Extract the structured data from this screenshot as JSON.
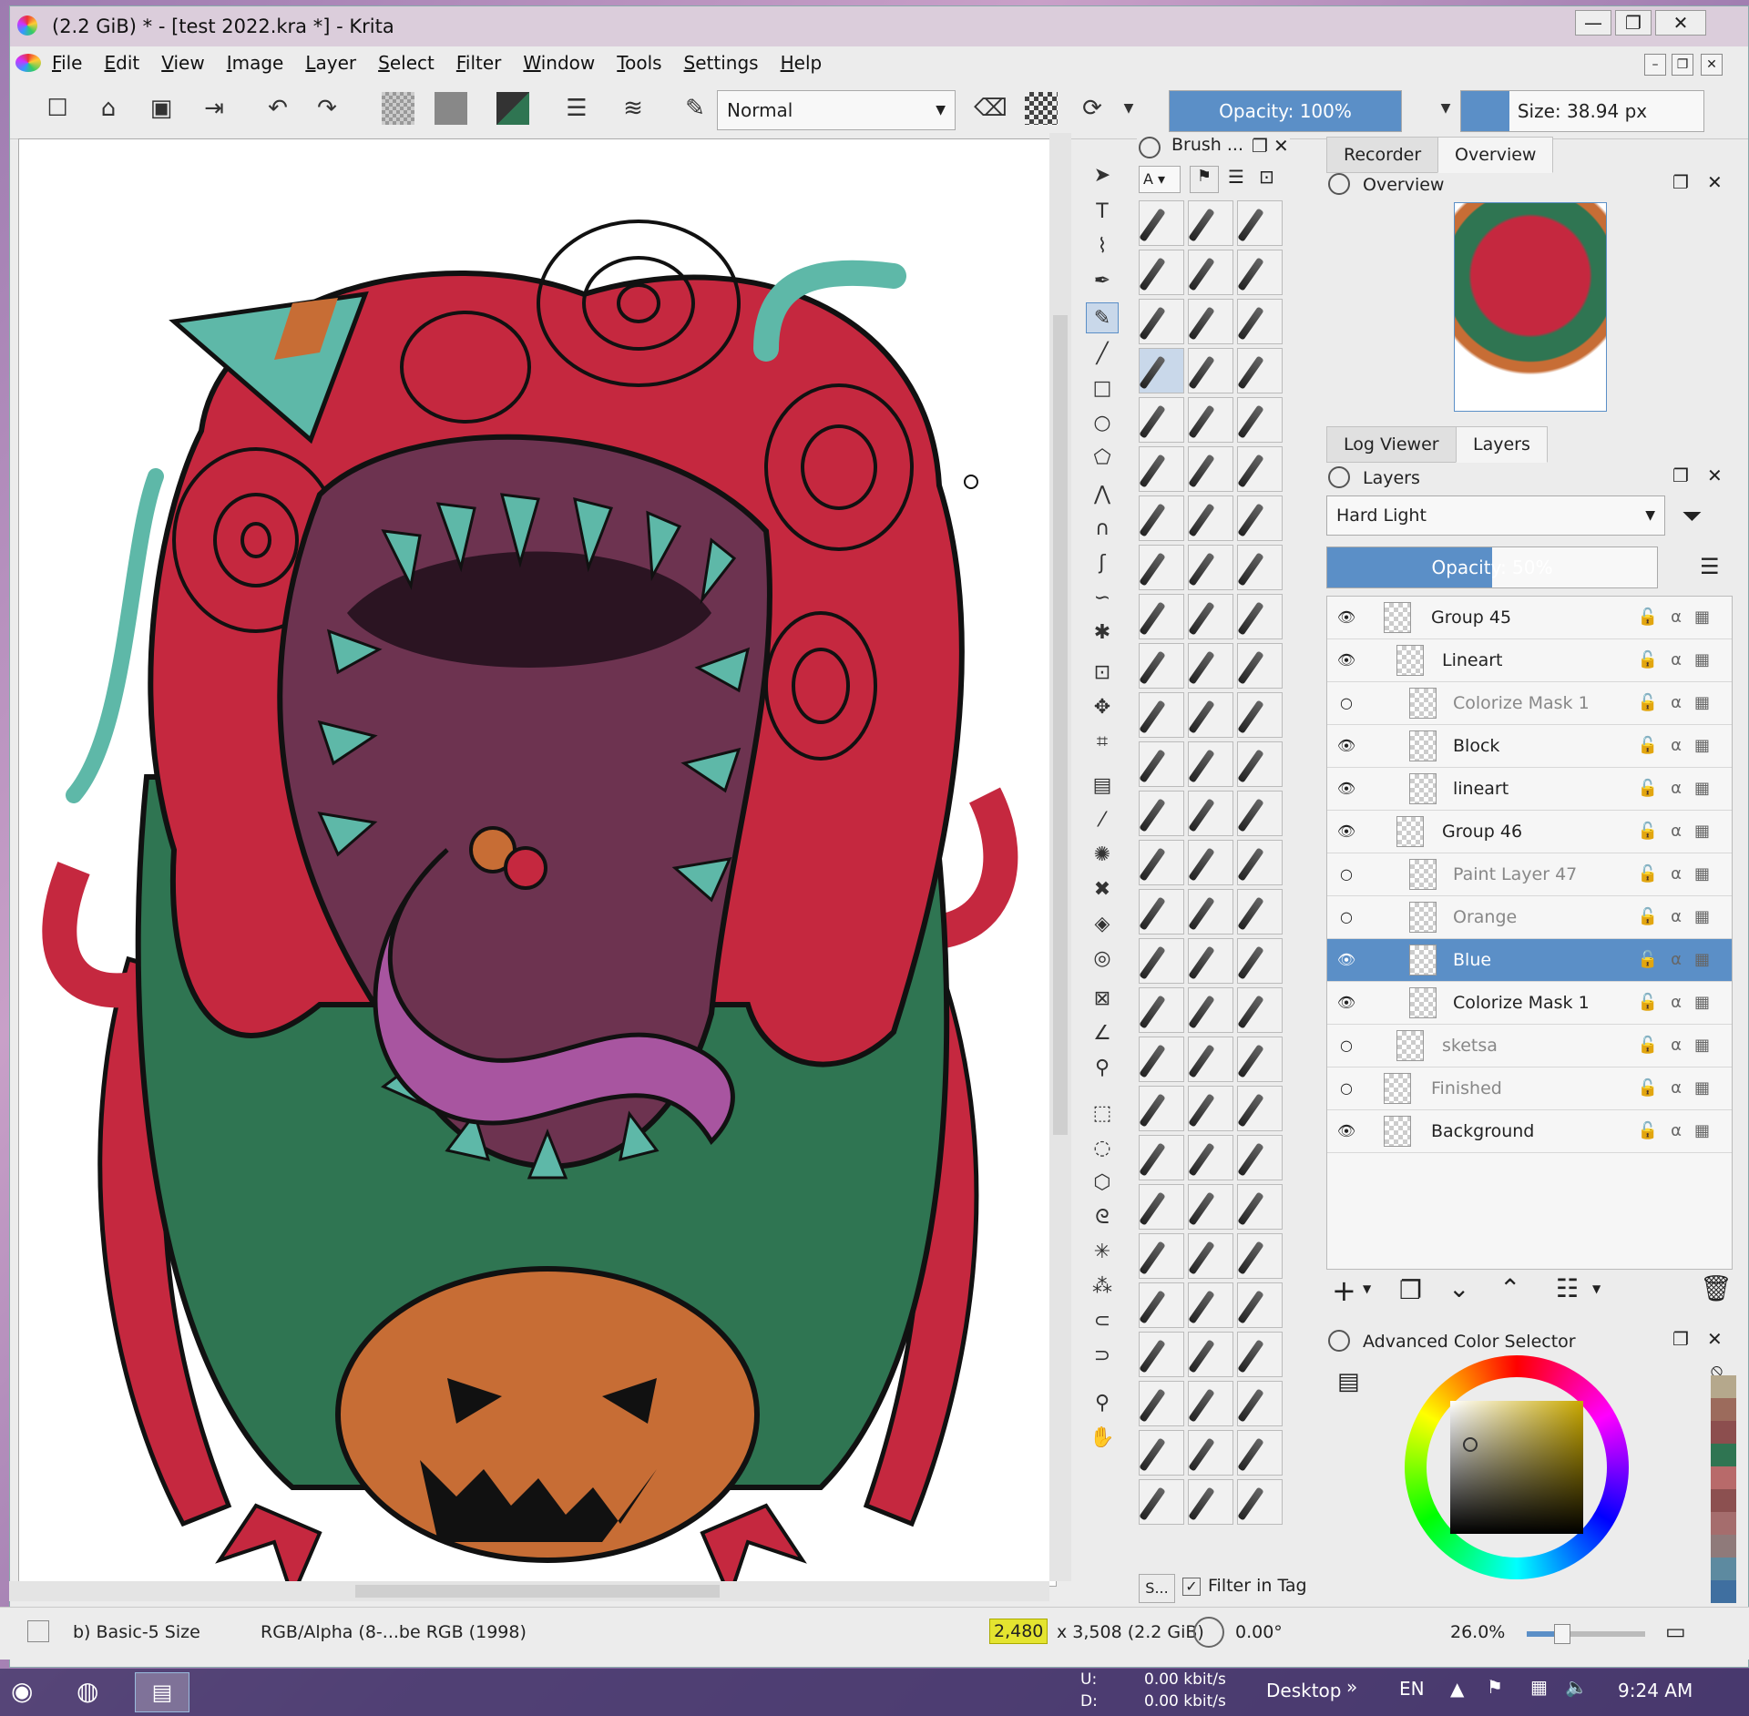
{
  "window": {
    "title": "(2.2 GiB)  * - [test 2022.kra *] - Krita",
    "controls": [
      "—",
      "❐",
      "✕"
    ]
  },
  "menu": [
    "File",
    "Edit",
    "View",
    "Image",
    "Layer",
    "Select",
    "Filter",
    "Window",
    "Tools",
    "Settings",
    "Help"
  ],
  "toolbar": {
    "blend_mode": "Normal",
    "opacity_label": "Opacity: 100%",
    "opacity_value": 1.0,
    "size_label": "Size: 38.94 px",
    "size_fill": 0.2
  },
  "brush_dock": {
    "title": "Brush ...",
    "tag_selector": "A",
    "search_label": "S...",
    "filter_label": "Filter in Tag",
    "filter_checked": true
  },
  "right_tabs_top": [
    "Recorder",
    "Overview"
  ],
  "overview": {
    "title": "Overview"
  },
  "right_tabs_mid": [
    "Log Viewer",
    "Layers"
  ],
  "layers": {
    "title": "Layers",
    "blend_mode": "Hard Light",
    "opacity_label": "Opacity:  50%",
    "opacity_value": 0.5,
    "items": [
      {
        "name": "Group 45",
        "visible": true,
        "selected": false,
        "dim": false
      },
      {
        "name": "Lineart",
        "visible": true,
        "selected": false,
        "dim": false
      },
      {
        "name": "Colorize Mask 1",
        "visible": false,
        "selected": false,
        "dim": true
      },
      {
        "name": "Block",
        "visible": true,
        "selected": false,
        "dim": false
      },
      {
        "name": "lineart",
        "visible": true,
        "selected": false,
        "dim": false
      },
      {
        "name": "Group 46",
        "visible": true,
        "selected": false,
        "dim": false
      },
      {
        "name": "Paint Layer 47",
        "visible": false,
        "selected": false,
        "dim": true
      },
      {
        "name": "Orange",
        "visible": false,
        "selected": false,
        "dim": true
      },
      {
        "name": "Blue",
        "visible": true,
        "selected": true,
        "dim": false
      },
      {
        "name": "Colorize Mask 1",
        "visible": true,
        "selected": false,
        "dim": false
      },
      {
        "name": "sketsa",
        "visible": false,
        "selected": false,
        "dim": true
      },
      {
        "name": "Finished",
        "visible": false,
        "selected": false,
        "dim": true
      },
      {
        "name": "Background",
        "visible": true,
        "selected": false,
        "dim": false
      }
    ]
  },
  "color_selector": {
    "title": "Advanced Color Selector"
  },
  "status": {
    "brush": "b) Basic-5 Size",
    "color_space": "RGB/Alpha (8-...be RGB (1998)",
    "width": "2,480",
    "dims_rest": " x 3,508 (2.2 GiB)",
    "rotation": "0.00°",
    "zoom": "26.0%"
  },
  "taskbar": {
    "net_u_label": "U:",
    "net_d_label": "D:",
    "net_u": "0.00 kbit/s",
    "net_d": "0.00 kbit/s",
    "desktop": "Desktop",
    "lang": "EN",
    "time": "9:24 AM"
  },
  "colors": {
    "accent": "#5b8fc7",
    "red": "#c5283f",
    "green": "#2f7552",
    "teal": "#5eb8a8",
    "orange": "#c76d35",
    "purple": "#6d3350"
  }
}
